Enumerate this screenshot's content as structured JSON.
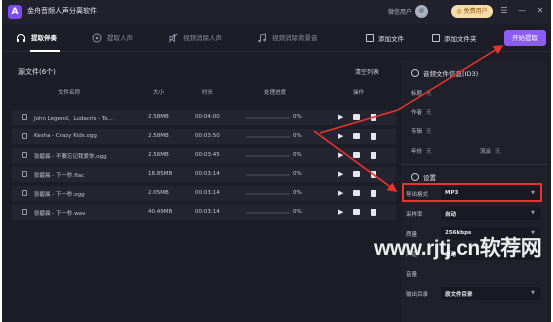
{
  "app": {
    "title": "金舟音频人声分离软件",
    "logo_letter": "A"
  },
  "titlebar": {
    "user_label": "微信用户",
    "vip_label": "免费用户",
    "menu_icon": "menu-icon",
    "minimize_icon": "minimize-icon",
    "close_icon": "close-icon"
  },
  "tabs": [
    {
      "label": "提取伴奏",
      "icon": "headphones-icon",
      "active": true
    },
    {
      "label": "提取人声",
      "icon": "vocal-icon",
      "active": false
    },
    {
      "label": "视频消除人声",
      "icon": "mute-icon",
      "active": false
    },
    {
      "label": "视频消除背景音",
      "icon": "music-note-icon",
      "active": false
    }
  ],
  "toolbar": {
    "add_file": "添加文件",
    "add_folder": "添加文件夹",
    "start": "开始提取"
  },
  "source": {
    "title": "源文件(6个)",
    "clear_list": "清空列表",
    "columns": {
      "name": "文件名称",
      "size": "大小",
      "duration": "时长",
      "progress": "处理进度",
      "action": "操作"
    },
    "rows": [
      {
        "name": "John Legend、Ludacris - To...",
        "size": "2.58MB",
        "duration": "00:04:00",
        "progress": "0%"
      },
      {
        "name": "Kesha - Crazy Kids.ogg",
        "size": "2.58MB",
        "duration": "00:03:50",
        "progress": "0%"
      },
      {
        "name": "张碧晨 - 不要忘记我爱你.ogg",
        "size": "2.56MB",
        "duration": "00:03:45",
        "progress": "0%"
      },
      {
        "name": "张碧晨 - 下一秒.flac",
        "size": "18.85MB",
        "duration": "00:03:14",
        "progress": "0%"
      },
      {
        "name": "张碧晨 - 下一秒.ogg",
        "size": "2.05MB",
        "duration": "00:03:14",
        "progress": "0%"
      },
      {
        "name": "张碧晨 - 下一秒.wav",
        "size": "40.49MB",
        "duration": "00:03:14",
        "progress": "0%"
      }
    ]
  },
  "info": {
    "title": "音频文件信息(ID3)",
    "fields": {
      "title_label": "标题",
      "title_value": "无",
      "author_label": "作者",
      "author_value": "无",
      "album_label": "专辑",
      "album_value": "无",
      "year_label": "年份",
      "year_value": "无",
      "genre_label": "流派",
      "genre_value": "无"
    }
  },
  "settings": {
    "title": "设置",
    "rows": [
      {
        "label": "导出格式",
        "value": "MP3"
      },
      {
        "label": "采样率",
        "value": "自动"
      },
      {
        "label": "质量",
        "value": "256kbps"
      },
      {
        "label": "声道",
        "value": "自动"
      },
      {
        "label": "音量",
        "value": ""
      },
      {
        "label": "输出目录",
        "value": "原文件目录"
      }
    ]
  },
  "watermark": {
    "text": "www.rjtj.cn软荐网"
  },
  "colors": {
    "accent": "#8b5cf6",
    "highlight": "#e8332e",
    "background": "#1c1d27"
  }
}
